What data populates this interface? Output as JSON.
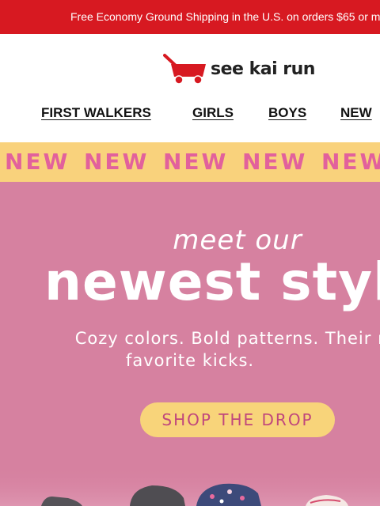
{
  "promo": {
    "text": "Free Economy Ground Shipping in the U.S. on orders $65 or m"
  },
  "brand": {
    "name": "see kai run",
    "logo_color": "#d71921"
  },
  "nav": {
    "items": [
      {
        "label": "FIRST WALKERS"
      },
      {
        "label": "GIRLS"
      },
      {
        "label": "BOYS"
      },
      {
        "label": "NEW"
      }
    ]
  },
  "ticker": {
    "items": [
      "NEW",
      "NEW",
      "NEW",
      "NEW",
      "NEW"
    ]
  },
  "hero": {
    "kicker": "meet our",
    "title": "newest styl",
    "subtitle_line1": "Cozy colors. Bold patterns. Their ne",
    "subtitle_line2": "favorite kicks.",
    "cta_label": "SHOP THE DROP",
    "background": "#d681a0"
  },
  "colors": {
    "promo_bg": "#d71921",
    "ticker_bg": "#f9d27c",
    "ticker_text": "#e2619c",
    "cta_bg": "#f8d47a",
    "cta_text": "#c0477c"
  }
}
